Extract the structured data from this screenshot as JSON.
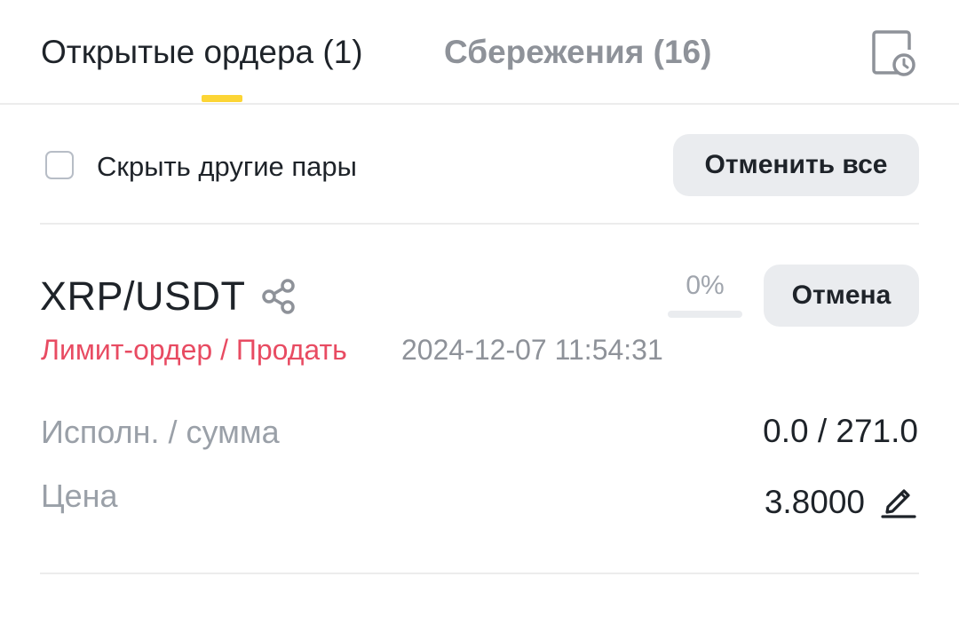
{
  "tabs": {
    "open_orders": "Открытые ордера (1)",
    "savings": "Сбережения (16)",
    "history_icon": "order-history-clock-icon"
  },
  "filter": {
    "hide_other_pairs": "Скрыть другие пары",
    "hide_other_pairs_checked": false,
    "cancel_all": "Отменить все"
  },
  "order": {
    "pair": "XRP/USDT",
    "share_icon": "share-icon",
    "fill_percent_text": "0%",
    "fill_fraction": 0,
    "cancel": "Отмена",
    "type_side": "Лимит-ордер / Продать",
    "timestamp": "2024-12-07 11:54:31",
    "filled_amount_label": "Исполн. / сумма",
    "filled_amount_value": "0.0 / 271.0",
    "price_label": "Цена",
    "price_value": "3.8000",
    "edit_icon": "edit-pencil-icon"
  },
  "colors": {
    "accent_yellow": "#fcd535",
    "sell_red": "#e84b62",
    "muted_gray": "#8e9299",
    "button_bg": "#eaecef"
  }
}
